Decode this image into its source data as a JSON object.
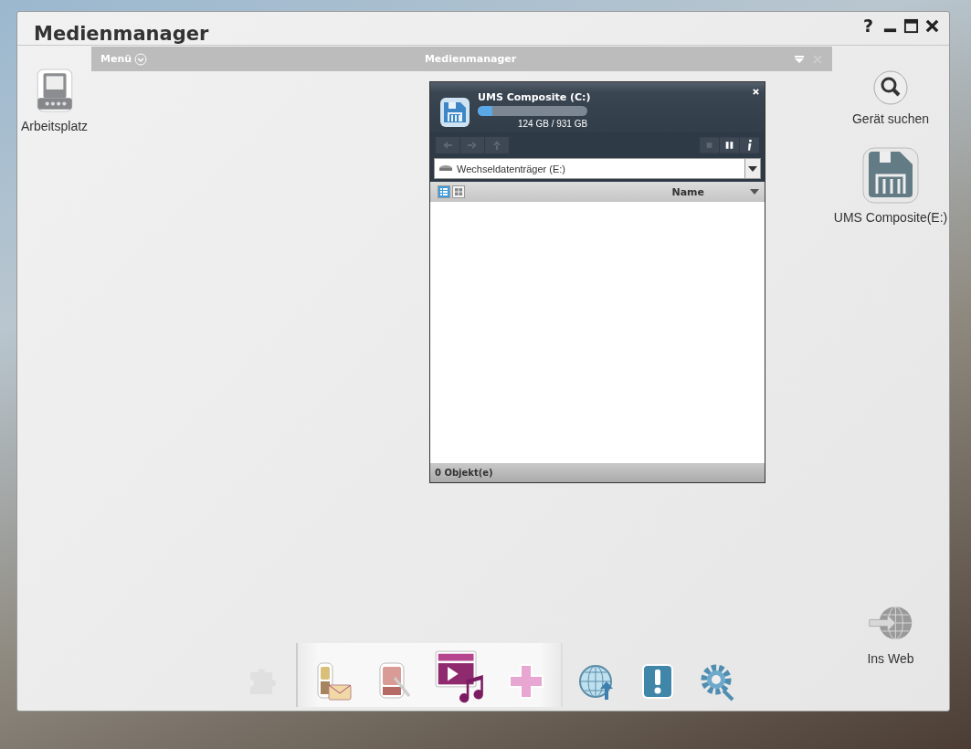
{
  "window": {
    "title": "Medienmanager",
    "help": "?"
  },
  "menubar": {
    "menu": "Menü",
    "title": "Medienmanager"
  },
  "left_icons": [
    {
      "kind": "computer",
      "label": "Arbeitsplatz"
    }
  ],
  "right_icons": [
    {
      "kind": "search",
      "label": "Gerät suchen"
    },
    {
      "kind": "drive",
      "label": "UMS Composite(E:)"
    }
  ],
  "bottom_right_icon": {
    "kind": "web",
    "label": "Ins Web"
  },
  "panel": {
    "title": "UMS Composite (C:)",
    "usage": "124 GB / 931 GB",
    "level": 0.13,
    "location": "Wechseldatenträger (E:)",
    "views": [
      {
        "kind": "list",
        "selected": true
      },
      {
        "kind": "grid",
        "selected": false
      }
    ],
    "column": "Name",
    "status": "0 Objekt(e)"
  },
  "dock": [
    {
      "items": [
        {
          "kind": "puzzle",
          "disabled": true
        }
      ]
    },
    {
      "items": [
        {
          "kind": "phone-mail",
          "disabled": false
        },
        {
          "kind": "pda",
          "disabled": false
        },
        {
          "kind": "video-music",
          "disabled": false
        },
        {
          "kind": "plus",
          "disabled": false
        }
      ]
    },
    {
      "items": [
        {
          "kind": "globe",
          "disabled": false
        },
        {
          "kind": "alert",
          "disabled": false
        },
        {
          "kind": "gear",
          "disabled": false
        }
      ]
    }
  ]
}
